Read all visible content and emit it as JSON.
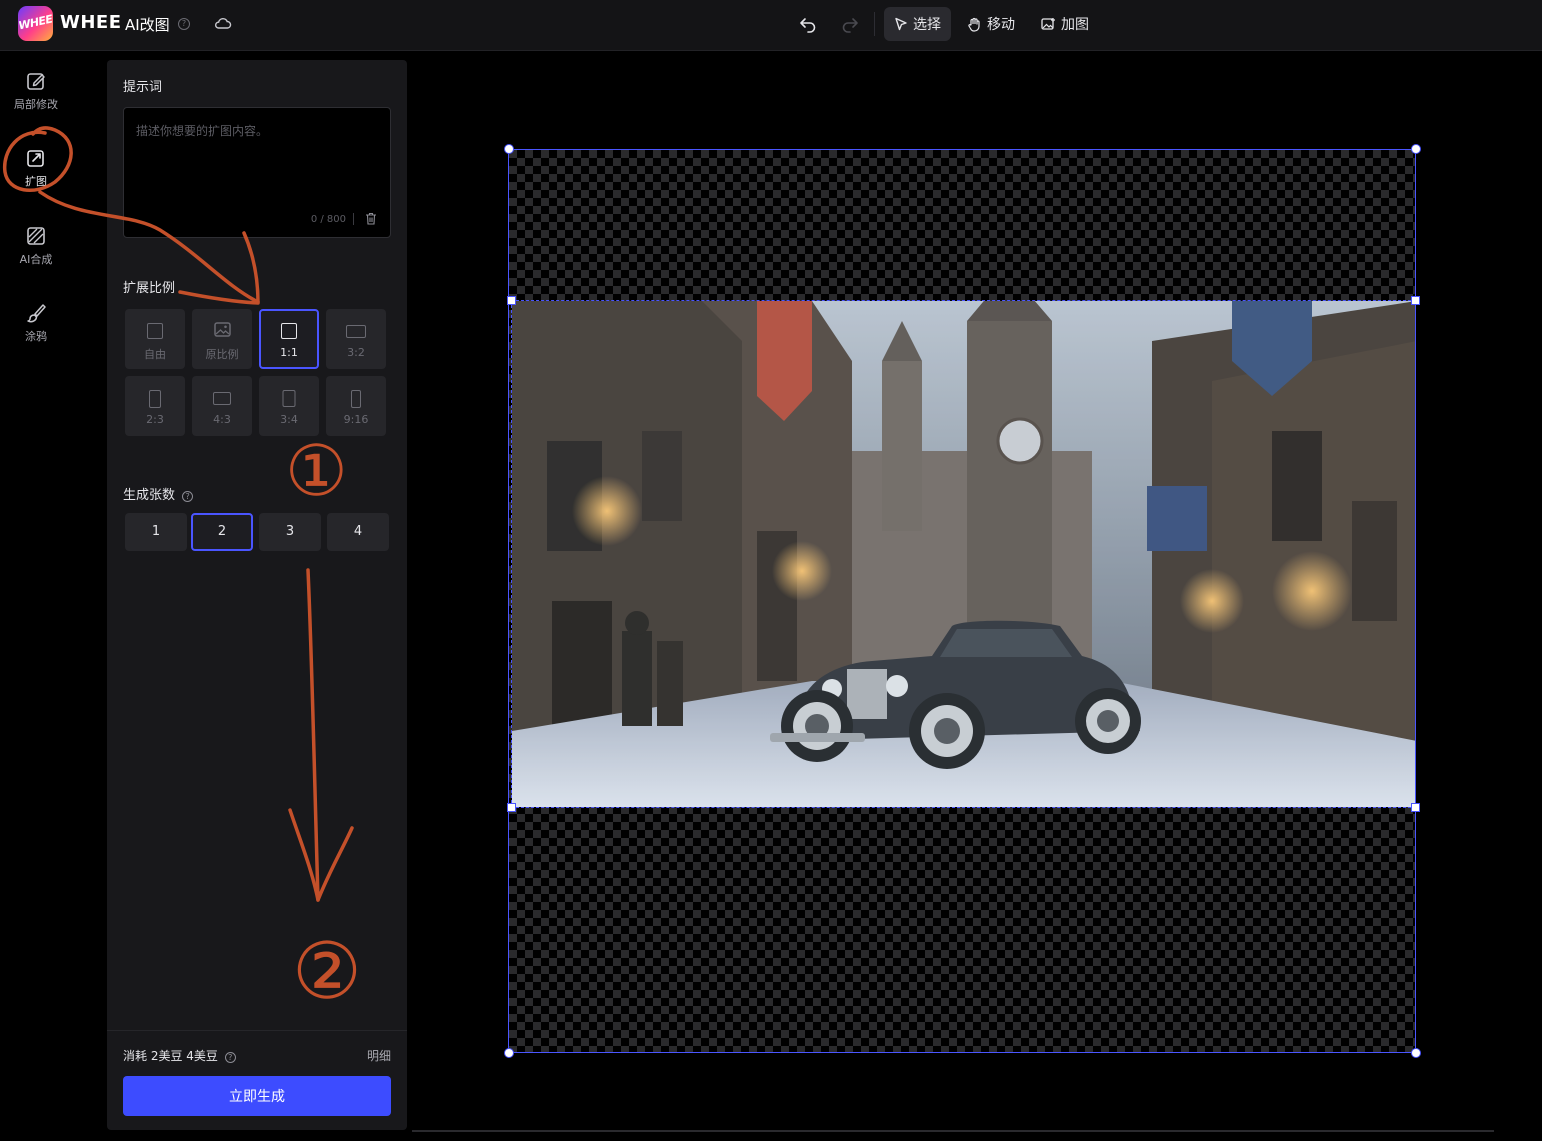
{
  "header": {
    "logo_text": "WHEE",
    "brand": "WHEE",
    "app_name": "AI改图",
    "help_symbol": "?",
    "tools": [
      {
        "label": "选择",
        "icon": "cursor-icon",
        "active": true
      },
      {
        "label": "移动",
        "icon": "hand-icon",
        "active": false
      },
      {
        "label": "加图",
        "icon": "add-image-icon",
        "active": false
      }
    ]
  },
  "sidebar": {
    "items": [
      {
        "label": "局部修改",
        "icon": "edit-icon"
      },
      {
        "label": "扩图",
        "icon": "expand-icon"
      },
      {
        "label": "AI合成",
        "icon": "ai-compose-icon"
      },
      {
        "label": "涂鸦",
        "icon": "brush-icon"
      }
    ]
  },
  "panel": {
    "prompt_title": "提示词",
    "prompt_placeholder": "描述你想要的扩图内容。",
    "prompt_value": "",
    "prompt_counter": "0 / 800",
    "ratio_title": "扩展比例",
    "ratios": [
      {
        "label": "自由",
        "selected": false
      },
      {
        "label": "原比例",
        "selected": false
      },
      {
        "label": "1:1",
        "selected": true
      },
      {
        "label": "3:2",
        "selected": false
      },
      {
        "label": "2:3",
        "selected": false
      },
      {
        "label": "4:3",
        "selected": false
      },
      {
        "label": "3:4",
        "selected": false
      },
      {
        "label": "9:16",
        "selected": false
      }
    ],
    "count_title": "生成张数",
    "counts": [
      {
        "label": "1",
        "selected": false
      },
      {
        "label": "2",
        "selected": true
      },
      {
        "label": "3",
        "selected": false
      },
      {
        "label": "4",
        "selected": false
      }
    ],
    "cost_label": "消耗 2美豆 4美豆",
    "detail_label": "明细",
    "generate_label": "立即生成"
  },
  "annotations": {
    "mark_1": "①",
    "mark_2": "②"
  },
  "colors": {
    "accent": "#4a55ff",
    "generate_button": "#3d4cff",
    "annotation": "#c4502a",
    "panel_bg": "#18181b"
  }
}
